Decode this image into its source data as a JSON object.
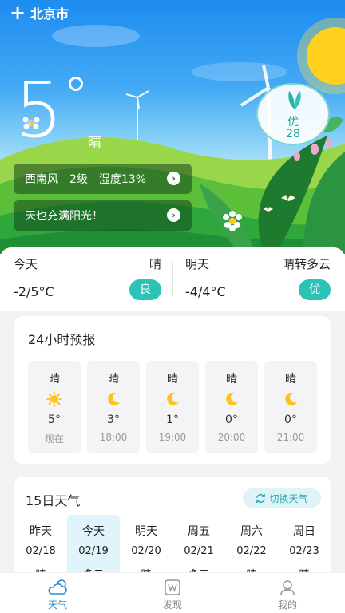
{
  "header": {
    "add_icon": "plus-icon",
    "city": "北京市"
  },
  "current": {
    "temperature": "5",
    "condition": "晴",
    "aqi": {
      "level": "优",
      "value": "28",
      "color": "#19a79a"
    }
  },
  "pills": [
    {
      "wind": "西南风",
      "wind_level": "2级",
      "humidity": "湿度13%"
    },
    {
      "tip": "天也充满阳光！"
    }
  ],
  "summary": {
    "today": {
      "label": "今天",
      "condition": "晴",
      "range": "-2/5°C",
      "aqi": "良"
    },
    "tomorrow": {
      "label": "明天",
      "condition": "晴转多云",
      "range": "-4/4°C",
      "aqi": "优"
    },
    "aqi_color": "#2cc3b7"
  },
  "hourly": {
    "title": "24小时预报",
    "items": [
      {
        "condition": "晴",
        "icon": "sun-icon",
        "temp": "5°",
        "time": "现在"
      },
      {
        "condition": "晴",
        "icon": "moon-icon",
        "temp": "3°",
        "time": "18:00"
      },
      {
        "condition": "晴",
        "icon": "moon-icon",
        "temp": "1°",
        "time": "19:00"
      },
      {
        "condition": "晴",
        "icon": "moon-icon",
        "temp": "0°",
        "time": "20:00"
      },
      {
        "condition": "晴",
        "icon": "moon-icon",
        "temp": "0°",
        "time": "21:00"
      }
    ]
  },
  "daily": {
    "title": "15日天气",
    "switch_label": "切换天气",
    "days": [
      {
        "name": "昨天",
        "date": "02/18",
        "condition": "晴"
      },
      {
        "name": "今天",
        "date": "02/19",
        "condition": "多云"
      },
      {
        "name": "明天",
        "date": "02/20",
        "condition": "晴"
      },
      {
        "name": "周五",
        "date": "02/21",
        "condition": "多云"
      },
      {
        "name": "周六",
        "date": "02/22",
        "condition": "晴"
      },
      {
        "name": "周日",
        "date": "02/23",
        "condition": "晴"
      }
    ]
  },
  "nav": [
    {
      "label": "天气",
      "icon": "weather-cloud-icon",
      "active": true
    },
    {
      "label": "发现",
      "icon": "discover-icon",
      "active": false
    },
    {
      "label": "我的",
      "icon": "profile-icon",
      "active": false
    }
  ],
  "colors": {
    "accent": "#2a8ad5",
    "teal": "#2cc3b7",
    "sky": "#1e8cf0"
  }
}
